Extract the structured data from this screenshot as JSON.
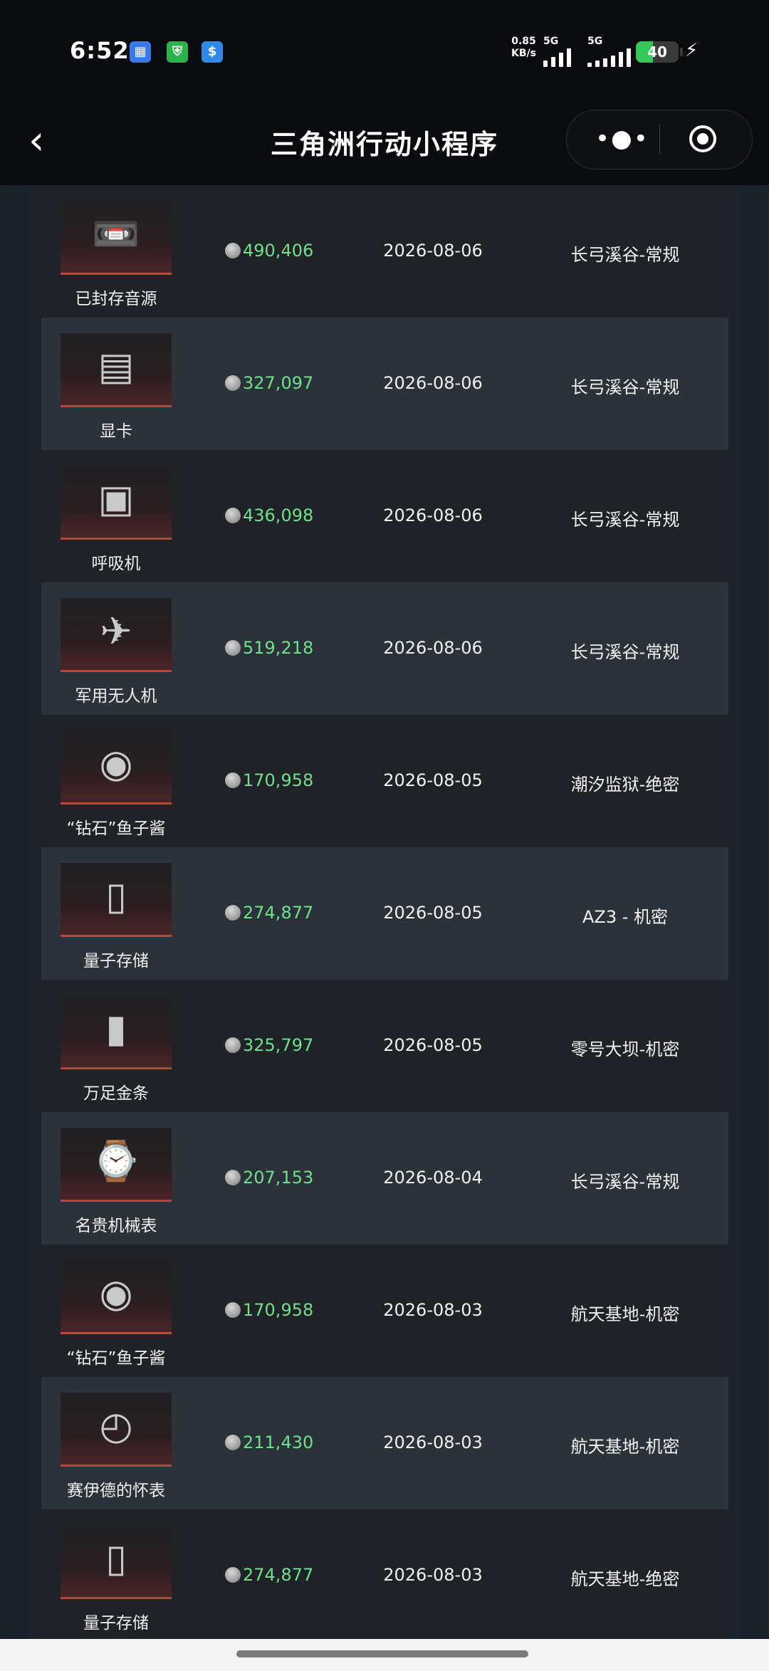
{
  "status_bar": {
    "time": "6:52",
    "net_speed_value": "0.85",
    "net_speed_unit": "KB/s",
    "sim1_label": "5G",
    "sim2_label": "5G",
    "battery_level": "40",
    "battery_fraction": 0.4,
    "notification_icons": [
      "app-icon",
      "shield-icon",
      "dollar-icon"
    ]
  },
  "header": {
    "title": "三角洲行动小程序",
    "back_icon": "chevron-left-icon",
    "more_icon": "more-dots-icon",
    "close_icon": "target-circle-icon"
  },
  "records": [
    {
      "name": "已封存音源",
      "icon": "reel-recorder-icon",
      "price": "490,406",
      "date": "2026-08-06",
      "map": "长弓溪谷-常规"
    },
    {
      "name": "显卡",
      "icon": "graphics-card-icon",
      "price": "327,097",
      "date": "2026-08-06",
      "map": "长弓溪谷-常规"
    },
    {
      "name": "呼吸机",
      "icon": "ventilator-icon",
      "price": "436,098",
      "date": "2026-08-06",
      "map": "长弓溪谷-常规"
    },
    {
      "name": "军用无人机",
      "icon": "drone-icon",
      "price": "519,218",
      "date": "2026-08-06",
      "map": "长弓溪谷-常规"
    },
    {
      "name": "“钻石”鱼子酱",
      "icon": "caviar-tin-icon",
      "price": "170,958",
      "date": "2026-08-05",
      "map": "潮汐监狱-绝密"
    },
    {
      "name": "量子存储",
      "icon": "usb-drive-icon",
      "price": "274,877",
      "date": "2026-08-05",
      "map": "AZ3 - 机密"
    },
    {
      "name": "万足金条",
      "icon": "gold-bar-icon",
      "price": "325,797",
      "date": "2026-08-05",
      "map": "零号大坝-机密"
    },
    {
      "name": "名贵机械表",
      "icon": "watch-icon",
      "price": "207,153",
      "date": "2026-08-04",
      "map": "长弓溪谷-常规"
    },
    {
      "name": "“钻石”鱼子酱",
      "icon": "caviar-tin-icon",
      "price": "170,958",
      "date": "2026-08-03",
      "map": "航天基地-机密"
    },
    {
      "name": "赛伊德的怀表",
      "icon": "pocket-watch-icon",
      "price": "211,430",
      "date": "2026-08-03",
      "map": "航天基地-机密"
    },
    {
      "name": "量子存储",
      "icon": "usb-drive-icon",
      "price": "274,877",
      "date": "2026-08-03",
      "map": "航天基地-绝密"
    }
  ],
  "colors": {
    "price": "#6fe08a",
    "row_dark": "#1f2226",
    "row_light": "#2b323a",
    "thumb_accent": "#c2413f",
    "battery": "#34c759"
  }
}
